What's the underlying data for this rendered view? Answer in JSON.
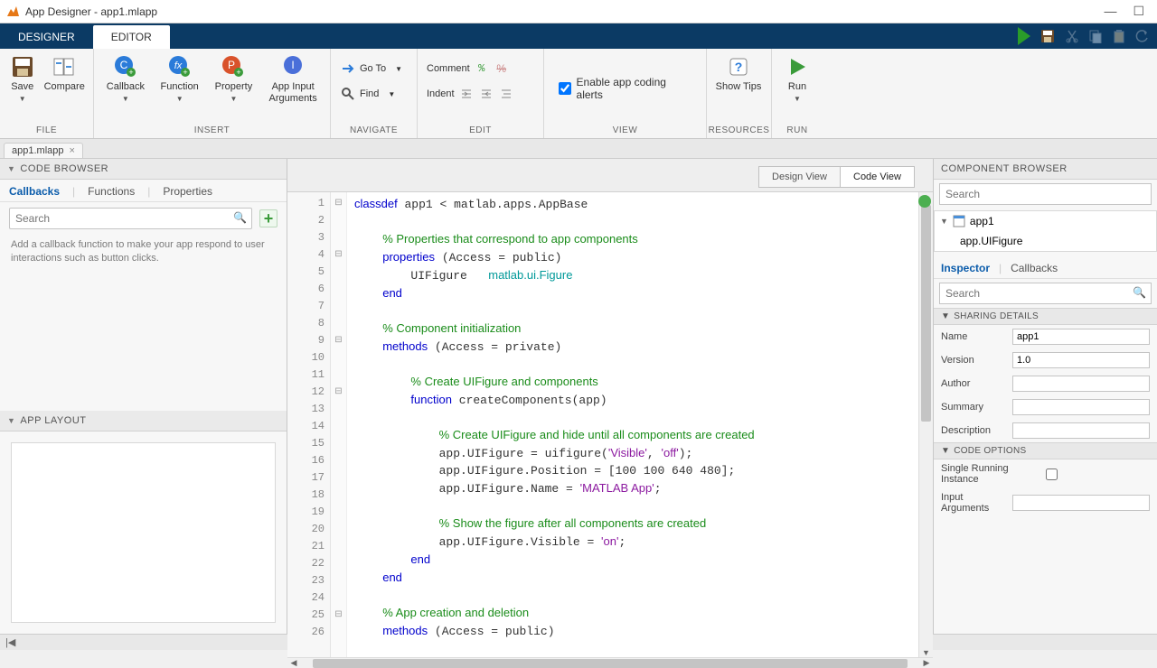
{
  "window": {
    "title": "App Designer - app1.mlapp"
  },
  "tabs": {
    "designer": "DESIGNER",
    "editor": "EDITOR"
  },
  "ribbon": {
    "file": {
      "save": "Save",
      "compare": "Compare",
      "label": "FILE"
    },
    "insert": {
      "callback": "Callback",
      "function": "Function",
      "property": "Property",
      "appinput": "App Input\nArguments",
      "label": "INSERT"
    },
    "navigate": {
      "goto": "Go To",
      "find": "Find",
      "label": "NAVIGATE"
    },
    "edit": {
      "comment": "Comment",
      "indent": "Indent",
      "label": "EDIT"
    },
    "view": {
      "enable_alerts": "Enable app coding alerts",
      "label": "VIEW"
    },
    "resources": {
      "showtips": "Show Tips",
      "label": "RESOURCES"
    },
    "run": {
      "run": "Run",
      "label": "RUN"
    }
  },
  "filetab": {
    "name": "app1.mlapp"
  },
  "codebrowser": {
    "title": "CODE BROWSER",
    "tabs": {
      "callbacks": "Callbacks",
      "functions": "Functions",
      "properties": "Properties"
    },
    "search_placeholder": "Search",
    "hint": "Add a callback function to make your app respond to user interactions such as button clicks."
  },
  "applayout": {
    "title": "APP LAYOUT"
  },
  "viewtoggle": {
    "design": "Design View",
    "code": "Code View"
  },
  "code_lines": [
    {
      "n": 1,
      "f": "⊟",
      "html": "<span class='kw'>classdef</span> app1 &lt; matlab.apps.AppBase"
    },
    {
      "n": 2,
      "f": "",
      "html": ""
    },
    {
      "n": 3,
      "f": "",
      "html": "    <span class='com'>% Properties that correspond to app components</span>"
    },
    {
      "n": 4,
      "f": "⊟",
      "html": "    <span class='kw'>properties</span> (Access = public)"
    },
    {
      "n": 5,
      "f": "",
      "html": "        UIFigure   <span class='cls'>matlab.ui.Figure</span>"
    },
    {
      "n": 6,
      "f": "",
      "html": "    <span class='kw'>end</span>"
    },
    {
      "n": 7,
      "f": "",
      "html": ""
    },
    {
      "n": 8,
      "f": "",
      "html": "    <span class='com'>% Component initialization</span>"
    },
    {
      "n": 9,
      "f": "⊟",
      "html": "    <span class='kw'>methods</span> (Access = private)"
    },
    {
      "n": 10,
      "f": "",
      "html": ""
    },
    {
      "n": 11,
      "f": "",
      "html": "        <span class='com'>% Create UIFigure and components</span>"
    },
    {
      "n": 12,
      "f": "⊟",
      "html": "        <span class='kw'>function</span> createComponents(app)"
    },
    {
      "n": 13,
      "f": "",
      "html": ""
    },
    {
      "n": 14,
      "f": "",
      "html": "            <span class='com'>% Create UIFigure and hide until all components are created</span>"
    },
    {
      "n": 15,
      "f": "",
      "html": "            app.UIFigure = uifigure(<span class='str'>'Visible'</span>, <span class='str'>'off'</span>);"
    },
    {
      "n": 16,
      "f": "",
      "html": "            app.UIFigure.Position = [100 100 640 480];"
    },
    {
      "n": 17,
      "f": "",
      "html": "            app.UIFigure.Name = <span class='str'>'MATLAB App'</span>;"
    },
    {
      "n": 18,
      "f": "",
      "html": ""
    },
    {
      "n": 19,
      "f": "",
      "html": "            <span class='com'>% Show the figure after all components are created</span>"
    },
    {
      "n": 20,
      "f": "",
      "html": "            app.UIFigure.Visible = <span class='str'>'on'</span>;"
    },
    {
      "n": 21,
      "f": "",
      "html": "        <span class='kw'>end</span>"
    },
    {
      "n": 22,
      "f": "",
      "html": "    <span class='kw'>end</span>"
    },
    {
      "n": 23,
      "f": "",
      "html": ""
    },
    {
      "n": 24,
      "f": "",
      "html": "    <span class='com'>% App creation and deletion</span>"
    },
    {
      "n": 25,
      "f": "⊟",
      "html": "    <span class='kw'>methods</span> (Access = public)"
    },
    {
      "n": 26,
      "f": "",
      "html": ""
    }
  ],
  "componentbrowser": {
    "title": "COMPONENT BROWSER",
    "search_placeholder": "Search",
    "tree": {
      "root": "app1",
      "child": "app.UIFigure"
    },
    "insp_tabs": {
      "inspector": "Inspector",
      "callbacks": "Callbacks"
    },
    "insp_search_placeholder": "Search",
    "sections": {
      "sharing": {
        "title": "SHARING DETAILS",
        "name_label": "Name",
        "name_value": "app1",
        "version_label": "Version",
        "version_value": "1.0",
        "author_label": "Author",
        "author_value": "",
        "summary_label": "Summary",
        "summary_value": "",
        "description_label": "Description",
        "description_value": ""
      },
      "codeopts": {
        "title": "CODE OPTIONS",
        "single_label": "Single Running Instance",
        "inputargs_label": "Input Arguments",
        "inputargs_value": ""
      }
    }
  }
}
